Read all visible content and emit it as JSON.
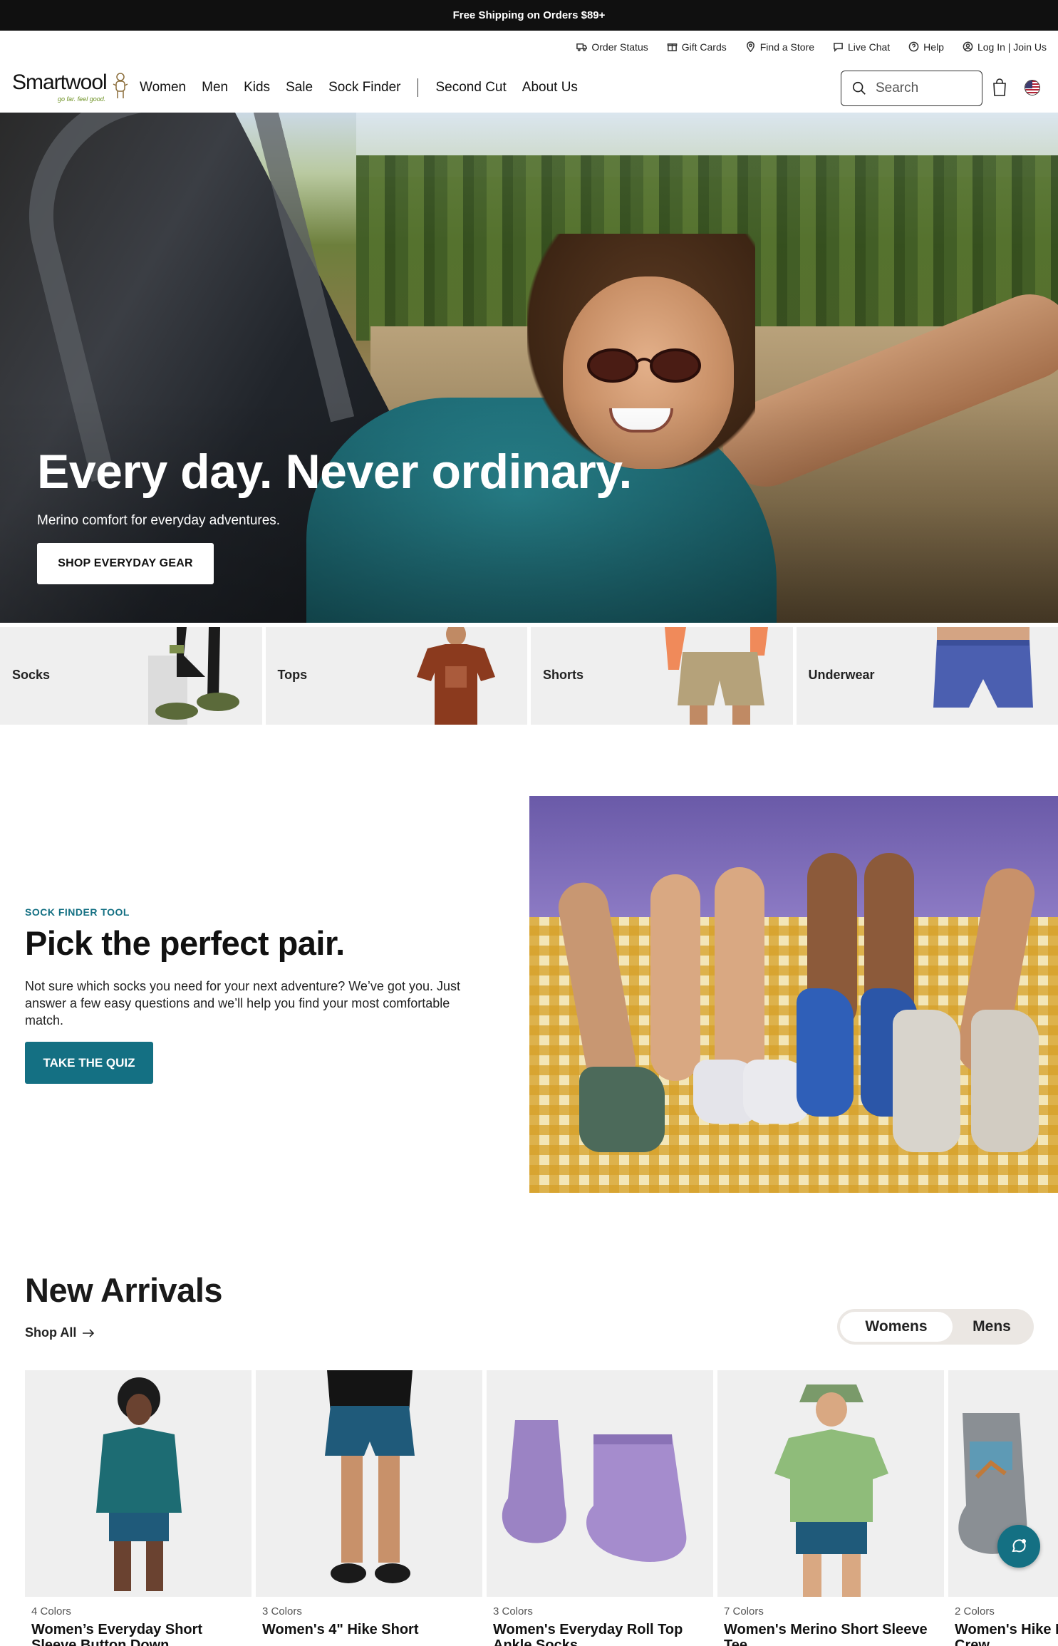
{
  "promo": {
    "text": "Free Shipping on Orders $89+"
  },
  "utility": {
    "order_status": "Order Status",
    "gift_cards": "Gift Cards",
    "find_store": "Find a Store",
    "live_chat": "Live Chat",
    "help": "Help",
    "login": "Log In | Join Us"
  },
  "brand": {
    "name": "Smartwool",
    "tagline": "go far. feel good."
  },
  "nav": {
    "women": "Women",
    "men": "Men",
    "kids": "Kids",
    "sale": "Sale",
    "sock_finder": "Sock Finder",
    "second_cut": "Second Cut",
    "about": "About Us"
  },
  "search": {
    "placeholder": "Search"
  },
  "hero": {
    "title": "Every day. Never ordinary.",
    "subtitle": "Merino comfort for everyday adventures.",
    "cta": "SHOP EVERYDAY GEAR"
  },
  "categories": [
    {
      "label": "Socks"
    },
    {
      "label": "Tops"
    },
    {
      "label": "Shorts"
    },
    {
      "label": "Underwear"
    }
  ],
  "sock_finder": {
    "eyebrow": "SOCK FINDER TOOL",
    "title": "Pick the perfect pair.",
    "body": "Not sure which socks you need for your next adventure? We’ve got you. Just answer a few easy questions and we’ll help you find your most comfortable match.",
    "cta": "TAKE THE QUIZ"
  },
  "new_arrivals": {
    "title": "New Arrivals",
    "shop_all": "Shop All",
    "toggle": {
      "womens": "Womens",
      "mens": "Mens",
      "selected": "Womens"
    },
    "products": [
      {
        "colors": "4 Colors",
        "name": "Women’s Everyday Short Sleeve Button Down"
      },
      {
        "colors": "3 Colors",
        "name": "Women's 4\" Hike Short"
      },
      {
        "colors": "3 Colors",
        "name": "Women's Everyday Roll Top Ankle Socks"
      },
      {
        "colors": "7 Colors",
        "name": "Women's Merino Short Sleeve Tee"
      },
      {
        "colors": "2 Colors",
        "name": "Women's Hike Meadow Mid Crew"
      }
    ]
  },
  "colors": {
    "accent": "#147083",
    "promo_bg": "#101010",
    "tile_bg": "#efefef"
  }
}
